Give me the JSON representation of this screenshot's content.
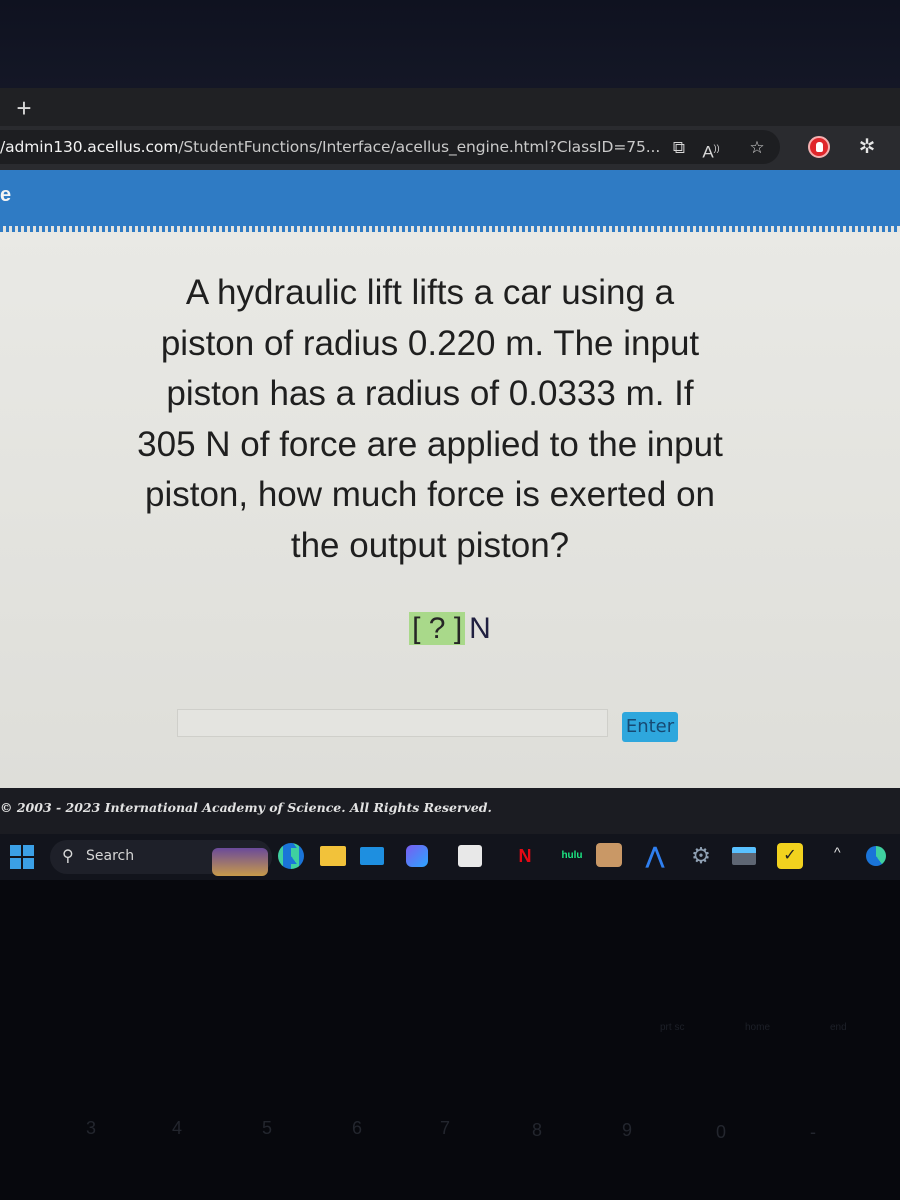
{
  "browser": {
    "new_tab_label": "+",
    "url_host": "/admin130.acellus.com",
    "url_path": "/StudentFunctions/Interface/acellus_engine.html?ClassID=75...",
    "toolbar_icons": [
      "open-in-app-icon",
      "read-aloud-icon",
      "favorites-add-icon",
      "adblock-extension-icon",
      "extensions-icon"
    ]
  },
  "page_header": {
    "title_fragment": "e",
    "color": "#2f7bc4"
  },
  "question": {
    "text": "A hydraulic lift lifts a car using a piston of radius 0.220 m. The input piston has a radius of 0.0333 m. If 305 N of force are applied to the input piston, how much force is exerted on the output piston?",
    "lines": [
      "A hydraulic lift lifts a car using a",
      "piston of radius 0.220 m. The input",
      "piston has a radius of 0.0333 m. If",
      "305 N of force are applied to the input",
      "piston, how much force is exerted on",
      "the output piston?"
    ]
  },
  "answer": {
    "placeholder_slot": "[ ? ]",
    "unit": "N",
    "input_value": "",
    "enter_label": "Enter",
    "slot_color": "#a9d98a",
    "button_color": "#2ea7dd"
  },
  "footer": {
    "copyright": "© 2003 - 2023 International Academy of Science.  All Rights Reserved."
  },
  "taskbar": {
    "search_label": "Search",
    "apps": [
      "start",
      "search",
      "widgets",
      "edge",
      "file-explorer",
      "mail",
      "copilot",
      "microsoft-store",
      "netflix",
      "hulu",
      "game",
      "app-a",
      "settings",
      "remote-desktop",
      "norton"
    ],
    "netflix_label": "N",
    "hulu_label": "hulu",
    "tray_chevron": "^"
  },
  "keyboard": {
    "number_row": [
      "3",
      "4",
      "5",
      "6",
      "7",
      "8",
      "9",
      "0",
      "-"
    ],
    "symbol_row": [
      "#",
      "$",
      "%",
      "^",
      "&",
      "*",
      "(",
      ")",
      "_"
    ],
    "fn_labels": [
      "prt sc",
      "home",
      "end"
    ]
  }
}
